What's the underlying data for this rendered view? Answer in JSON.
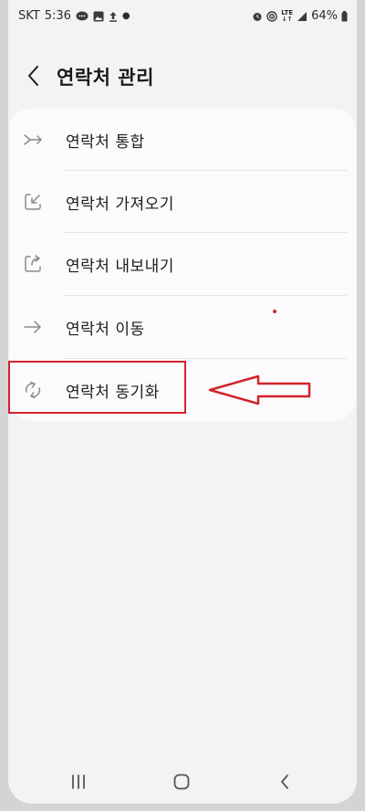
{
  "status_bar": {
    "carrier": "SKT",
    "time": "5:36",
    "network": "LTE",
    "battery": "64%"
  },
  "header": {
    "title": "연락처 관리"
  },
  "menu": {
    "items": [
      {
        "label": "연락처 통합",
        "icon": "merge-icon"
      },
      {
        "label": "연락처 가져오기",
        "icon": "import-icon"
      },
      {
        "label": "연락처 내보내기",
        "icon": "export-icon"
      },
      {
        "label": "연락처 이동",
        "icon": "move-arrow-icon"
      },
      {
        "label": "연락처 동기화",
        "icon": "sync-icon"
      }
    ]
  },
  "colors": {
    "annotation": "#d2232a",
    "background": "#f3f3f5",
    "card": "#fbfbfd"
  }
}
